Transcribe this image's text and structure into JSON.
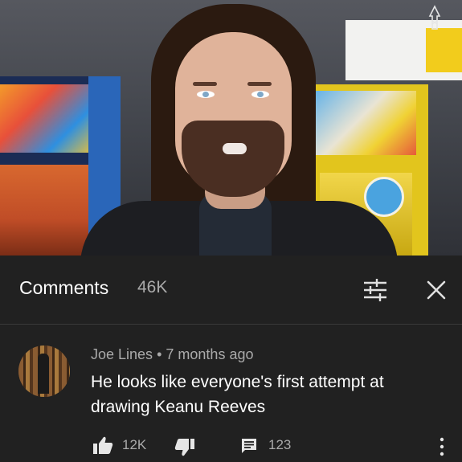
{
  "comments_panel": {
    "title": "Comments",
    "count": "46K",
    "filter_icon": "sort-filter-icon",
    "close_icon": "close-icon"
  },
  "comment": {
    "author": "Joe Lines",
    "separator": "•",
    "time": "7 months ago",
    "text": "He looks like everyone's first attempt at drawing Keanu Reeves",
    "likes": "12K",
    "replies": "123",
    "icons": [
      "thumbs-up-icon",
      "thumbs-down-icon",
      "reply-icon",
      "more-vertical-icon"
    ]
  },
  "colors": {
    "panel_bg": "#212121",
    "primary_text": "#ffffff",
    "secondary_text": "#aaaaaa"
  }
}
